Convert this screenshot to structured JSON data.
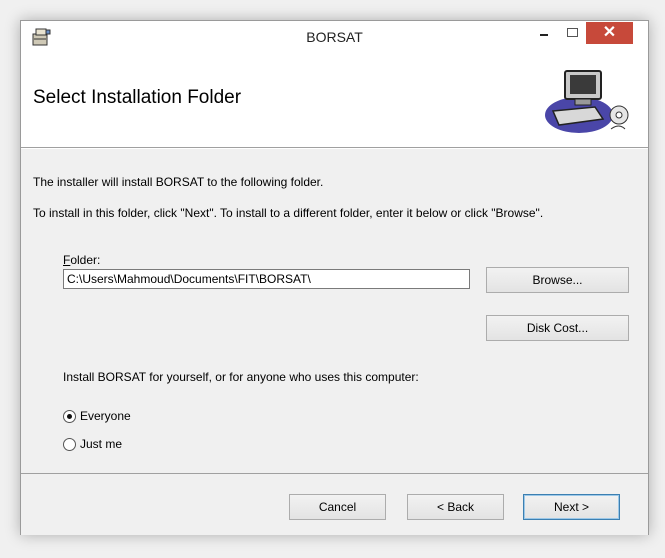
{
  "window": {
    "title": "BORSAT",
    "controls": {
      "minimize": "minimize",
      "maximize": "maximize",
      "close": "✕"
    }
  },
  "header": {
    "title": "Select Installation Folder"
  },
  "content": {
    "line1": "The installer will install BORSAT to the following folder.",
    "line2": "To install in this folder, click \"Next\". To install to a different folder, enter it below or click \"Browse\".",
    "folder_label_first": "F",
    "folder_label_rest": "older:",
    "folder_value": "C:\\Users\\Mahmoud\\Documents\\FIT\\BORSAT\\",
    "browse_label": "Browse...",
    "disk_cost_label": "Disk Cost...",
    "scope_text": "Install BORSAT for yourself, or for anyone who uses this computer:",
    "radio_options": [
      {
        "label": "Everyone",
        "checked": true
      },
      {
        "label": "Just me",
        "checked": false
      }
    ]
  },
  "footer": {
    "cancel_label": "Cancel",
    "back_label": "< Back",
    "next_label": "Next >"
  },
  "colors": {
    "close": "#c7493a",
    "panel": "#f0f0f0",
    "next_border": "#3c7fb1"
  }
}
